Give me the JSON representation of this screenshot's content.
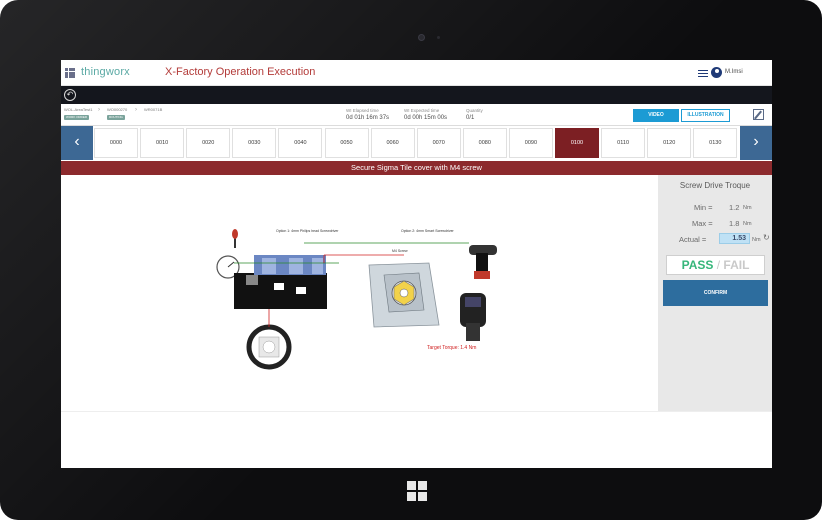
{
  "header": {
    "brand": "thingworx",
    "app_title": "X-Factory Operation Execution",
    "user": "M.Imsi"
  },
  "breadcrumb": [
    {
      "label": "WOL-AreaTest1",
      "badge": "WORK ORDER"
    },
    {
      "label": "WO000270",
      "badge": "ROUTING"
    },
    {
      "label": "WR0071B"
    }
  ],
  "stats": [
    {
      "label": "WI Elapsed time",
      "value": "0d 01h 16m 37s"
    },
    {
      "label": "WI Expected time",
      "value": "0d 00h 15m 00s"
    },
    {
      "label": "Quantity",
      "value": "0/1"
    }
  ],
  "buttons": {
    "video": "VIDEO",
    "illustration": "ILLUSTRATION"
  },
  "steps": [
    "0000",
    "0010",
    "0020",
    "0030",
    "0040",
    "0050",
    "0060",
    "0070",
    "0080",
    "0090",
    "0100",
    "0110",
    "0120",
    "0130"
  ],
  "active_step": "0100",
  "nav_arrows": {
    "prev": "‹",
    "next": "›"
  },
  "instruction": "Secure Sigma Tile cover with M4 screw",
  "screw_drive": {
    "title": "Screw Drive Troque",
    "min_label": "Min =",
    "min_value": "1.2",
    "max_label": "Max =",
    "max_value": "1.8",
    "actual_label": "Actual =",
    "actual_value": "1.53",
    "unit": "Nm",
    "pass": "PASS",
    "slash": "/",
    "fail": "FAIL",
    "confirm": "CONFIRM"
  },
  "illustration_labels": {
    "option1": "Option 1: 4mm Philips head Screwdriver",
    "option2": "Option 2: 4mm Smart Screwdriver",
    "m4": "M4 Screw",
    "target": "Target Torque: 1.4 Nm"
  },
  "colors": {
    "brand": "#5aa9a4",
    "title": "#b33b39",
    "banner": "#8c2a2d",
    "active_step": "#7c1f23",
    "arrow": "#3d6894",
    "pass": "#36b67a",
    "confirm": "#2d6d9e",
    "video": "#1c9bd4"
  }
}
